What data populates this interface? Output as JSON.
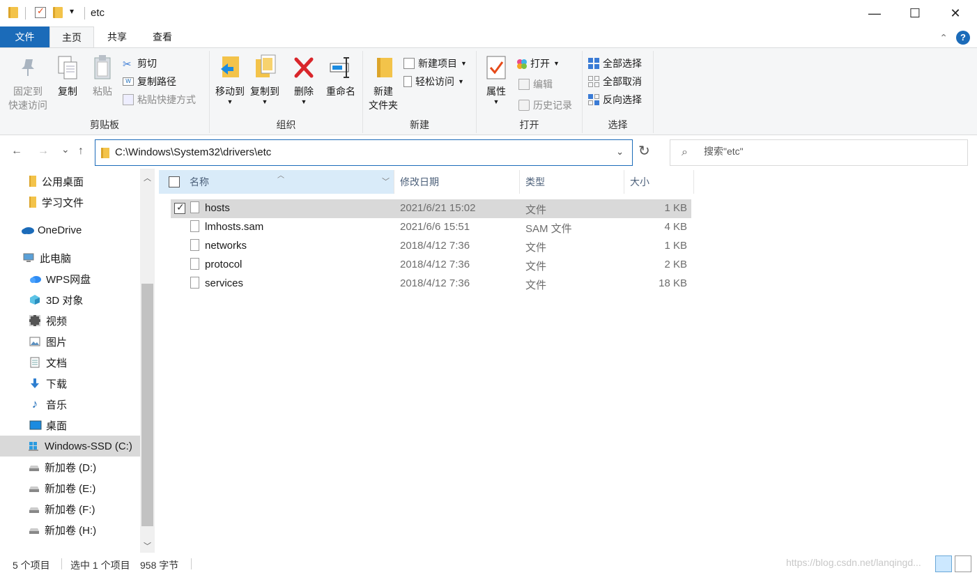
{
  "window": {
    "title": "etc",
    "minimize": "—",
    "maximize": "☐",
    "close": "✕",
    "qat_dropdown": "▾"
  },
  "ribbon_tabs": {
    "file": "文件",
    "home": "主页",
    "share": "共享",
    "view": "查看",
    "collapse": "⌃",
    "help": "?"
  },
  "ribbon": {
    "clipboard": {
      "label": "剪贴板",
      "pin_line1": "固定到",
      "pin_line2": "快速访问",
      "copy": "复制",
      "paste": "粘贴",
      "cut": "剪切",
      "copy_path": "复制路径",
      "paste_shortcut": "粘贴快捷方式"
    },
    "organize": {
      "label": "组织",
      "move_to": "移动到",
      "copy_to": "复制到",
      "delete": "删除",
      "rename": "重命名"
    },
    "new": {
      "label": "新建",
      "new_folder_line1": "新建",
      "new_folder_line2": "文件夹",
      "new_item": "新建项目",
      "easy_access": "轻松访问"
    },
    "open": {
      "label": "打开",
      "properties": "属性",
      "open": "打开",
      "edit": "编辑",
      "history": "历史记录"
    },
    "select": {
      "label": "选择",
      "select_all": "全部选择",
      "select_none": "全部取消",
      "invert": "反向选择"
    }
  },
  "address": {
    "path": "C:\\Windows\\System32\\drivers\\etc",
    "back": "←",
    "forward": "→",
    "recent": "⌄",
    "up": "↑",
    "dropdown": "⌄",
    "refresh": "↻",
    "search_placeholder": "搜索\"etc\""
  },
  "nav_pane": {
    "items": [
      {
        "label": "公用桌面",
        "icon": "folder-icon"
      },
      {
        "label": "学习文件",
        "icon": "folder-icon"
      },
      {
        "label": "OneDrive",
        "icon": "onedrive-icon"
      },
      {
        "label": "此电脑",
        "icon": "this-pc-icon"
      },
      {
        "label": "WPS网盘",
        "icon": "wps-cloud-icon"
      },
      {
        "label": "3D 对象",
        "icon": "3d-objects-icon"
      },
      {
        "label": "视频",
        "icon": "videos-icon"
      },
      {
        "label": "图片",
        "icon": "pictures-icon"
      },
      {
        "label": "文档",
        "icon": "documents-icon"
      },
      {
        "label": "下载",
        "icon": "downloads-icon"
      },
      {
        "label": "音乐",
        "icon": "music-icon"
      },
      {
        "label": "桌面",
        "icon": "desktop-icon"
      },
      {
        "label": "Windows-SSD (C:)",
        "icon": "windows-drive-icon"
      },
      {
        "label": "新加卷 (D:)",
        "icon": "drive-icon"
      },
      {
        "label": "新加卷 (E:)",
        "icon": "drive-icon"
      },
      {
        "label": "新加卷 (F:)",
        "icon": "drive-icon"
      },
      {
        "label": "新加卷 (H:)",
        "icon": "drive-icon"
      }
    ]
  },
  "file_list": {
    "columns": {
      "name": "名称",
      "date": "修改日期",
      "type": "类型",
      "size": "大小"
    },
    "rows": [
      {
        "name": "hosts",
        "date": "2021/6/21 15:02",
        "type": "文件",
        "size": "1 KB",
        "selected": true
      },
      {
        "name": "lmhosts.sam",
        "date": "2021/6/6 15:51",
        "type": "SAM 文件",
        "size": "4 KB",
        "selected": false
      },
      {
        "name": "networks",
        "date": "2018/4/12 7:36",
        "type": "文件",
        "size": "1 KB",
        "selected": false
      },
      {
        "name": "protocol",
        "date": "2018/4/12 7:36",
        "type": "文件",
        "size": "2 KB",
        "selected": false
      },
      {
        "name": "services",
        "date": "2018/4/12 7:36",
        "type": "文件",
        "size": "18 KB",
        "selected": false
      }
    ]
  },
  "status": {
    "item_count": "5 个项目",
    "selection": "选中 1 个项目",
    "size": "958 字节",
    "watermark": "https://blog.csdn.net/lanqingd..."
  },
  "colors": {
    "accent": "#1b6bb9",
    "ribbon_bg": "#f5f6f7",
    "selection": "#d9d9d9",
    "folder": "#f3c34a"
  }
}
